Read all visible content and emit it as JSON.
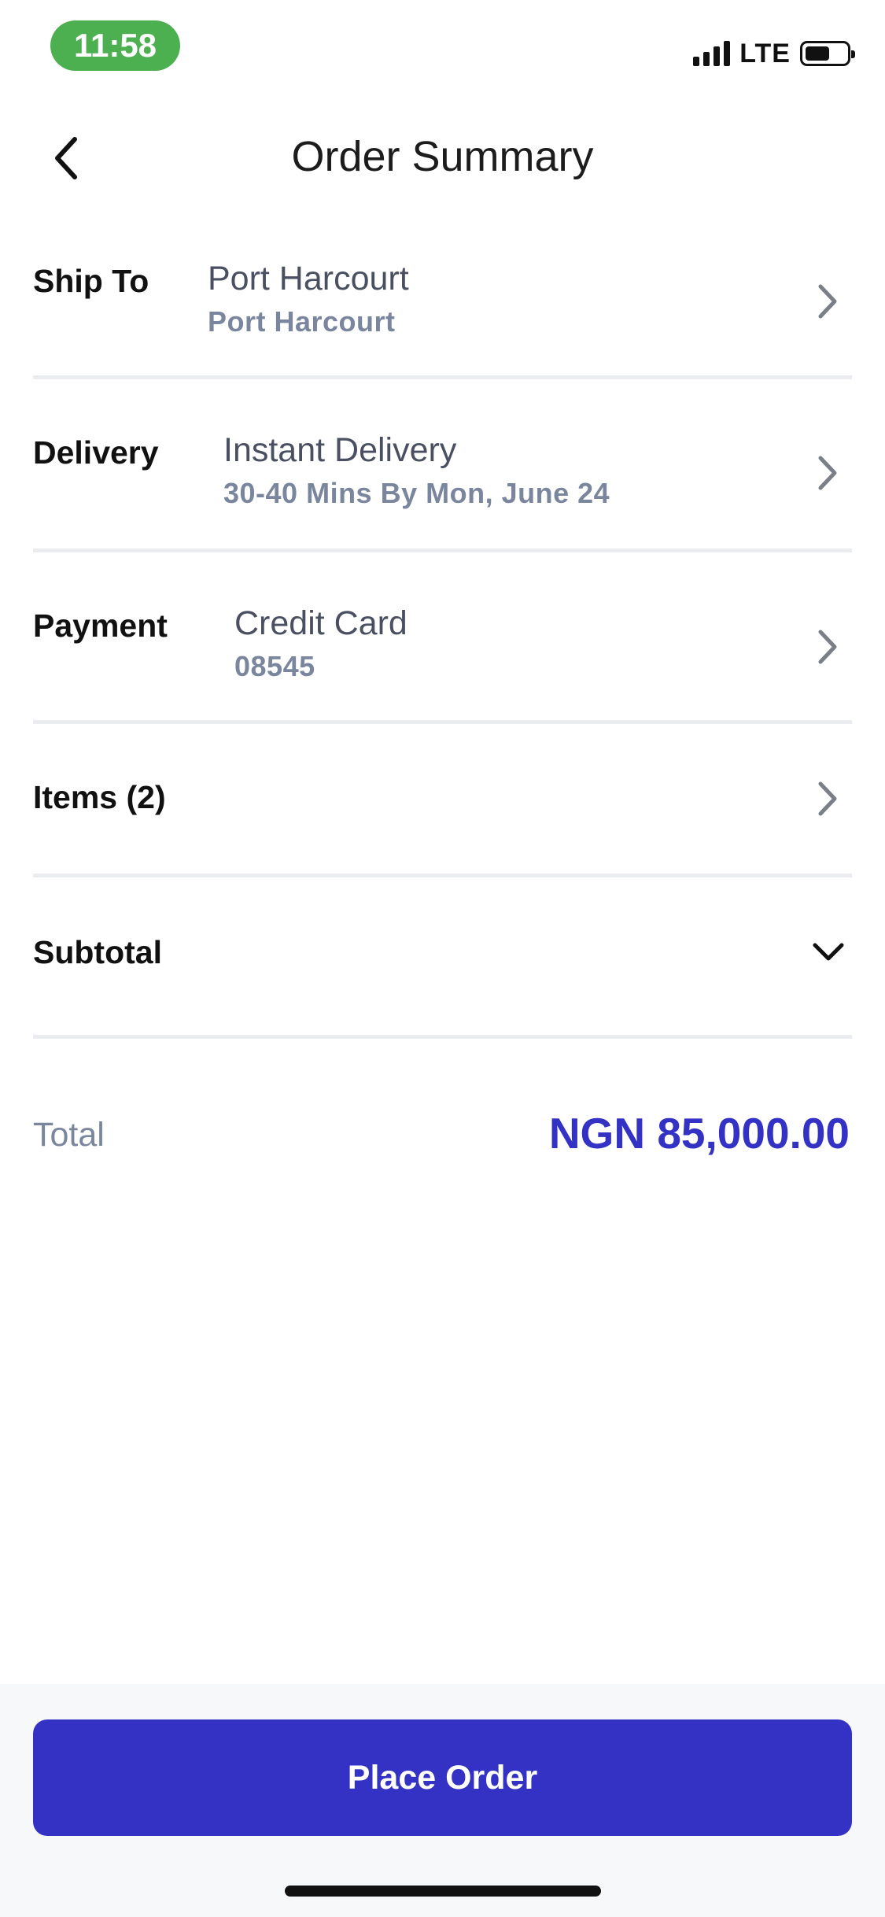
{
  "status_bar": {
    "time": "11:58",
    "network": "LTE",
    "battery_level": 0.6,
    "signal_bars": 4
  },
  "header": {
    "title": "Order Summary",
    "back_icon": "chevron-left-icon"
  },
  "rows": {
    "ship_to": {
      "label": "Ship To",
      "value": "Port Harcourt",
      "sub": "Port Harcourt"
    },
    "delivery": {
      "label": "Delivery",
      "value": "Instant Delivery",
      "sub": "30-40 Mins By Mon, June 24"
    },
    "payment": {
      "label": "Payment",
      "value": "Credit Card",
      "sub": "08545"
    },
    "items": {
      "label": "Items (2)"
    },
    "subtotal": {
      "label": "Subtotal",
      "icon": "chevron-down-icon"
    }
  },
  "total": {
    "label": "Total",
    "value": "NGN 85,000.00"
  },
  "footer": {
    "place_order_label": "Place Order"
  },
  "colors": {
    "accent": "#3432C4",
    "time_pill": "#4CAF50",
    "muted_text": "#7A869E",
    "divider": "#EBECF0",
    "footer_bg": "#F7F8FA"
  }
}
